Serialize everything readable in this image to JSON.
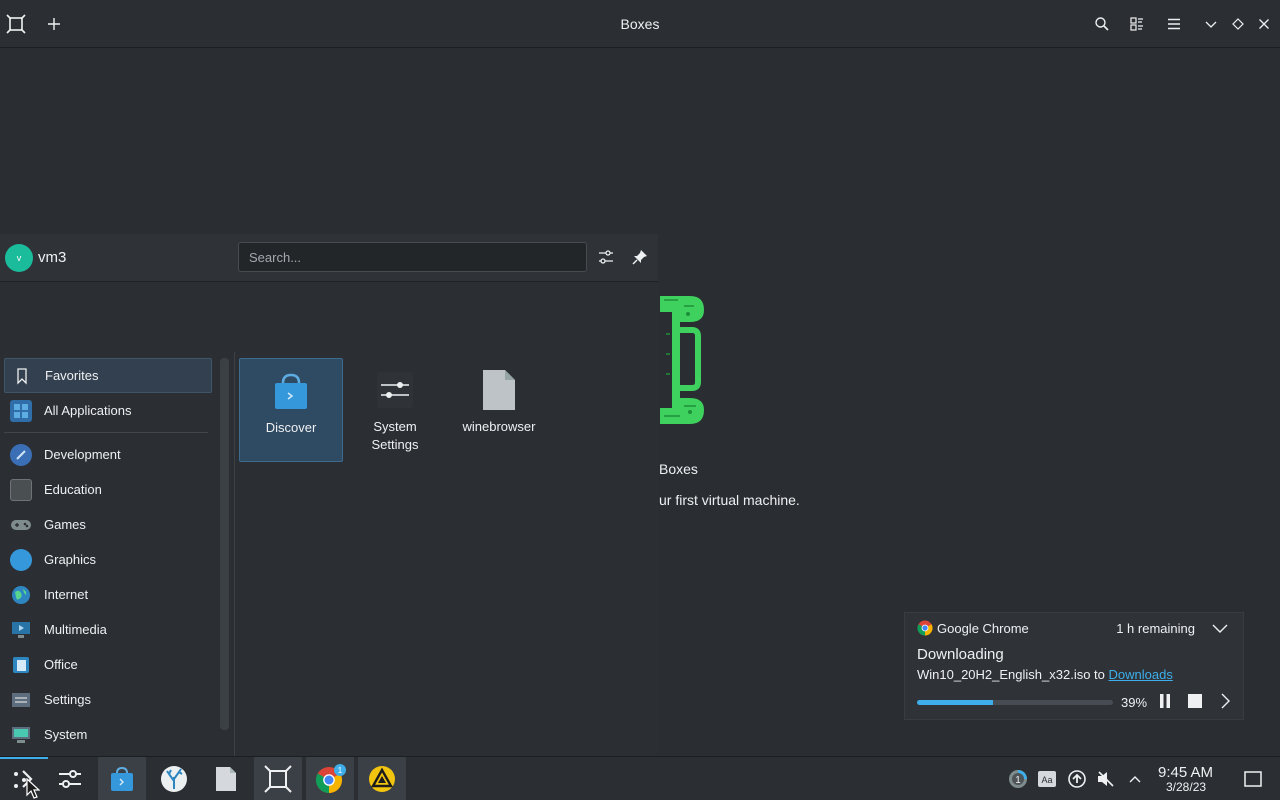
{
  "window": {
    "title": "Boxes"
  },
  "background_app": {
    "title": "Boxes",
    "subtitle": "ur first virtual machine."
  },
  "launcher": {
    "user": {
      "initial": "v",
      "name": "vm3"
    },
    "search": {
      "placeholder": "Search...",
      "value": ""
    },
    "categories": [
      {
        "label": "Favorites",
        "icon": "bookmark-icon",
        "active": true
      },
      {
        "label": "All Applications",
        "icon": "grid-icon",
        "active": false
      },
      {
        "label": "Development",
        "icon": "development-icon",
        "active": false
      },
      {
        "label": "Education",
        "icon": "education-icon",
        "active": false
      },
      {
        "label": "Games",
        "icon": "gamepad-icon",
        "active": false
      },
      {
        "label": "Graphics",
        "icon": "graphics-icon",
        "active": false
      },
      {
        "label": "Internet",
        "icon": "globe-icon",
        "active": false
      },
      {
        "label": "Multimedia",
        "icon": "multimedia-icon",
        "active": false
      },
      {
        "label": "Office",
        "icon": "office-icon",
        "active": false
      },
      {
        "label": "Settings",
        "icon": "settings-icon",
        "active": false
      },
      {
        "label": "System",
        "icon": "system-icon",
        "active": false
      }
    ],
    "apps": [
      {
        "label": "Discover",
        "icon": "shopping-bag-icon",
        "selected": true
      },
      {
        "label": "System\nSettings",
        "icon": "sliders-icon",
        "selected": false
      },
      {
        "label": "winebrowser",
        "icon": "file-icon",
        "selected": false
      }
    ]
  },
  "notification": {
    "app": "Google Chrome",
    "remaining": "1 h remaining",
    "title": "Downloading",
    "file": "Win10_20H2_English_x32.iso to ",
    "link": "Downloads",
    "progress": 0.39,
    "progress_label": "39%"
  },
  "taskbar": {
    "chrome_badge": "1",
    "tray_badge": "1",
    "tray_text_icon": "Aa",
    "time": "9:45 AM",
    "date": "3/28/23"
  },
  "colors": {
    "accent": "#3daee9",
    "background": "#2a2e32",
    "selection": "#2f4a63"
  }
}
